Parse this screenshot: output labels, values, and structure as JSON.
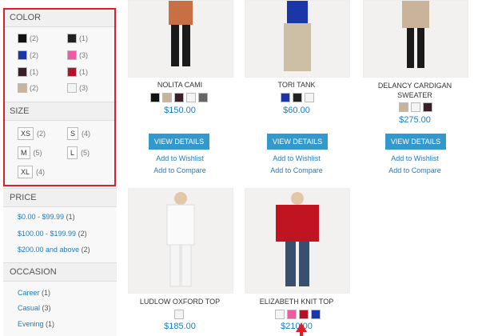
{
  "sidebar": {
    "color": {
      "title": "COLOR",
      "items": [
        {
          "color": "#111111",
          "count": "(2)"
        },
        {
          "color": "#222222",
          "count": "(1)"
        },
        {
          "color": "#1a36a8",
          "count": "(2)"
        },
        {
          "color": "#ee5aa4",
          "count": "(3)"
        },
        {
          "color": "#3a1f2a",
          "count": "(1)"
        },
        {
          "color": "#b5122a",
          "count": "(1)"
        },
        {
          "color": "#c9b49b",
          "count": "(2)"
        },
        {
          "color": "#f4f4f4",
          "count": "(3)"
        }
      ]
    },
    "size": {
      "title": "SIZE",
      "items": [
        {
          "label": "XS",
          "count": "(2)"
        },
        {
          "label": "S",
          "count": "(4)"
        },
        {
          "label": "M",
          "count": "(5)"
        },
        {
          "label": "L",
          "count": "(5)"
        },
        {
          "label": "XL",
          "count": "(4)"
        }
      ]
    },
    "price": {
      "title": "PRICE",
      "items": [
        {
          "label": "$0.00 - $99.99",
          "count": "(1)"
        },
        {
          "label": "$100.00 - $199.99",
          "count": "(2)"
        },
        {
          "label": "$200.00 and above",
          "count": "(2)"
        }
      ]
    },
    "occasion": {
      "title": "OCCASION",
      "items": [
        {
          "label": "Career",
          "count": "(1)"
        },
        {
          "label": "Casual",
          "count": "(3)"
        },
        {
          "label": "Evening",
          "count": "(1)"
        }
      ]
    }
  },
  "products": [
    {
      "name": "NOLITA CAMI",
      "price": "$150.00",
      "swatches": [
        "#111111",
        "#c9b49b",
        "#3a1f2a",
        "#f4f4f4",
        "#666666"
      ],
      "details": "VIEW DETAILS",
      "wishlist": "Add to Wishlist",
      "compare": "Add to Compare"
    },
    {
      "name": "TORI TANK",
      "price": "$60.00",
      "swatches": [
        "#1a36a8",
        "#222222",
        "#f4f4f4"
      ],
      "details": "VIEW DETAILS",
      "wishlist": "Add to Wishlist",
      "compare": "Add to Compare"
    },
    {
      "name": "DELANCY CARDIGAN SWEATER",
      "price": "$275.00",
      "swatches": [
        "#c9b49b",
        "#f4f4f4",
        "#3a1f2a"
      ],
      "details": "VIEW DETAILS",
      "wishlist": "Add to Wishlist",
      "compare": "Add to Compare"
    },
    {
      "name": "LUDLOW OXFORD TOP",
      "price": "$185.00",
      "swatches": [
        "#f4f4f4"
      ]
    },
    {
      "name": "ELIZABETH KNIT TOP",
      "price": "$210.00",
      "swatches": [
        "#f4f4f4",
        "#ee5aa4",
        "#b5122a",
        "#1a36a8"
      ]
    }
  ]
}
